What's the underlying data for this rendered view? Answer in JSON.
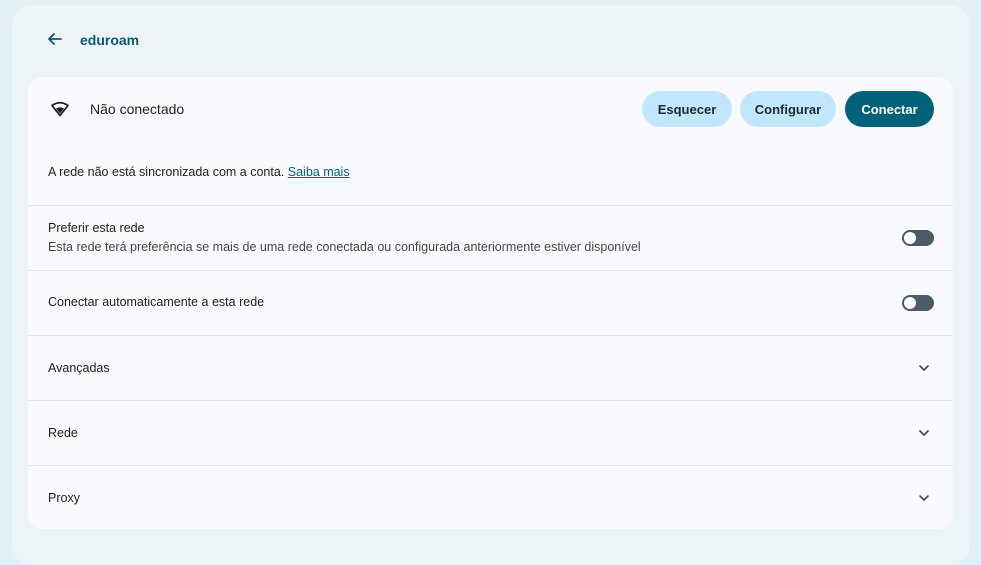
{
  "header": {
    "title": "eduroam",
    "back_icon": "arrow-back-icon"
  },
  "status": {
    "icon": "wifi-icon",
    "text": "Não conectado",
    "buttons": {
      "forget": "Esquecer",
      "configure": "Configurar",
      "connect": "Conectar"
    }
  },
  "sync": {
    "text": "A rede não está sincronizada com a conta.",
    "link": "Saiba mais"
  },
  "prefer": {
    "label": "Preferir esta rede",
    "description": "Esta rede terá preferência se mais de uma rede conectada ou configurada anteriormente estiver disponível",
    "enabled": false
  },
  "autoconnect": {
    "label": "Conectar automaticamente a esta rede",
    "enabled": false
  },
  "sections": [
    {
      "label": "Avançadas"
    },
    {
      "label": "Rede"
    },
    {
      "label": "Proxy"
    }
  ],
  "colors": {
    "accent": "#00627a",
    "tonal_button": "#c2e7fd",
    "toggle_off": "#4a5a66",
    "background": "#e3eff4"
  }
}
